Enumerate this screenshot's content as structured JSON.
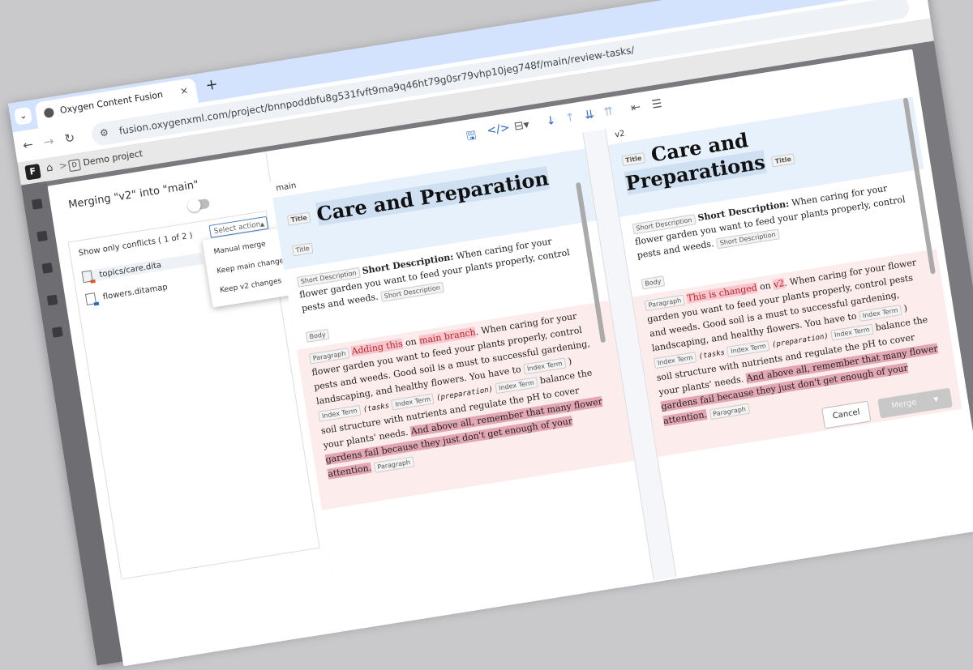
{
  "browser": {
    "tab_title": "Oxygen Content Fusion",
    "tab_close": "×",
    "new_tab": "+",
    "url": "fusion.oxygenxml.com/project/bnnpoddbfu8g531fvft9ma9q46ht79g0sr79vhp10jeg748f/main/review-tasks/"
  },
  "app": {
    "logo": "F",
    "breadcrumb_sep": ">",
    "project_icon": "D",
    "project_name": "Demo project"
  },
  "dialog": {
    "title": "Merging \"v2\" into \"main\"",
    "conflicts_label": "Show only conflicts ( 1 of 2 )",
    "select_action": "Select action",
    "files": [
      {
        "name": "topics/care.dita"
      },
      {
        "name": "flowers.ditamap"
      }
    ],
    "menu": [
      "Manual merge",
      "Keep main changes",
      "Keep v2 changes"
    ],
    "cancel": "Cancel",
    "merge": "Merge"
  },
  "panes": {
    "main": {
      "label": "main",
      "title": "Care and Preparation",
      "tag_title": "Title",
      "tag_shortdesc": "Short Description",
      "shortdesc_bold": "Short Description:",
      "shortdesc_text": "When caring for your flower garden you want to feed your plants properly, control pests and weeds.",
      "tag_body": "Body",
      "tag_para": "Paragraph",
      "para_added": "Adding this",
      "para_on": "on",
      "para_branch": "main branch",
      "para_rest": ". When caring for your flower garden you want to feed your plants properly, control pests and weeds. Good soil is a must to successful gardening, landscaping, and healthy flowers. You have to",
      "tag_index": "Index Term",
      "idx1": "(tasks",
      "idx2": "(preparation)",
      "para_tail": "balance the soil structure with nutrients and regulate the pH to cover your plants' needs.",
      "para_dark": "And above all, remember that many flower gardens fail because they just don't get enough of your attention."
    },
    "v2": {
      "label": "v2",
      "title_line1": "Care and",
      "title_line2": "Preparations",
      "para_changed": "This is changed",
      "para_on": "on",
      "para_v2": "v2",
      "para_rest": ". When caring for your flower garden you want to feed your plants properly, control pests and weeds. Good soil is a must to successful gardening, landscaping, and healthy flowers. You have to",
      "paren_close": ")"
    }
  }
}
